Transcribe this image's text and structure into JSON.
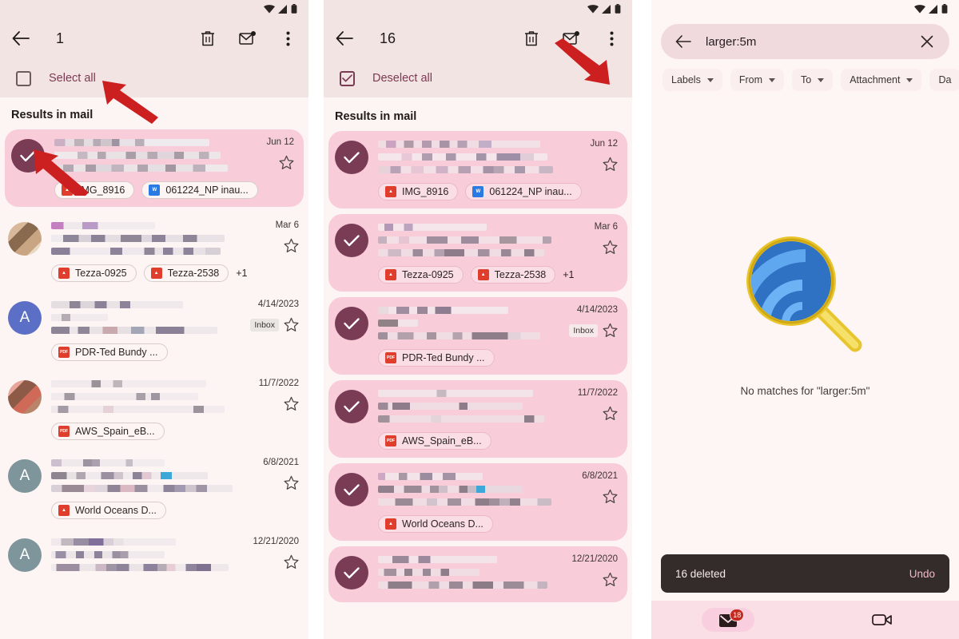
{
  "panel1": {
    "status_icons": [
      "wifi-icon",
      "signal-icon",
      "battery-icon"
    ],
    "actionbar": {
      "back": "back-arrow-icon",
      "count": "1",
      "delete": "trash-icon",
      "mark_unread": "mark-unread-icon",
      "more": "overflow-menu-icon"
    },
    "select_all_label": "Select all",
    "results_header": "Results in mail",
    "rows": [
      {
        "selected": true,
        "avatar_type": "check",
        "avatar_label": "",
        "date": "Jun 12",
        "tag": "",
        "chips": [
          {
            "label": "IMG_8916",
            "type": "img"
          },
          {
            "label": "061224_NP inau...",
            "type": "doc"
          }
        ],
        "extra": ""
      },
      {
        "selected": false,
        "avatar_type": "photo-tan",
        "avatar_label": "",
        "date": "Mar 6",
        "tag": "",
        "chips": [
          {
            "label": "Tezza-0925",
            "type": "img"
          },
          {
            "label": "Tezza-2538",
            "type": "img"
          }
        ],
        "extra": "+1"
      },
      {
        "selected": false,
        "avatar_type": "letter-blue",
        "avatar_label": "A",
        "date": "4/14/2023",
        "tag": "Inbox",
        "chips": [
          {
            "label": "PDR-Ted Bundy ...",
            "type": "pdf"
          }
        ],
        "extra": ""
      },
      {
        "selected": false,
        "avatar_type": "photo-red",
        "avatar_label": "",
        "date": "11/7/2022",
        "tag": "",
        "chips": [
          {
            "label": "AWS_Spain_eB...",
            "type": "pdf"
          }
        ],
        "extra": ""
      },
      {
        "selected": false,
        "avatar_type": "letter-gray",
        "avatar_label": "A",
        "date": "6/8/2021",
        "tag": "",
        "chips": [
          {
            "label": "World Oceans D...",
            "type": "img"
          }
        ],
        "extra": ""
      },
      {
        "selected": false,
        "avatar_type": "letter-gray",
        "avatar_label": "A",
        "date": "12/21/2020",
        "tag": "",
        "chips": [],
        "extra": ""
      }
    ]
  },
  "panel2": {
    "actionbar": {
      "back": "back-arrow-icon",
      "count": "16",
      "delete": "trash-icon",
      "mark_unread": "mark-unread-icon",
      "more": "overflow-menu-icon"
    },
    "select_all_label": "Deselect all",
    "results_header": "Results in mail",
    "rows": [
      {
        "date": "Jun 12",
        "tag": "",
        "chips": [
          {
            "label": "IMG_8916",
            "type": "img"
          },
          {
            "label": "061224_NP inau...",
            "type": "doc"
          }
        ],
        "extra": ""
      },
      {
        "date": "Mar 6",
        "tag": "",
        "chips": [
          {
            "label": "Tezza-0925",
            "type": "img"
          },
          {
            "label": "Tezza-2538",
            "type": "img"
          }
        ],
        "extra": "+1"
      },
      {
        "date": "4/14/2023",
        "tag": "Inbox",
        "chips": [
          {
            "label": "PDR-Ted Bundy ...",
            "type": "pdf"
          }
        ],
        "extra": ""
      },
      {
        "date": "11/7/2022",
        "tag": "",
        "chips": [
          {
            "label": "AWS_Spain_eB...",
            "type": "pdf"
          }
        ],
        "extra": ""
      },
      {
        "date": "6/8/2021",
        "tag": "",
        "chips": [
          {
            "label": "World Oceans D...",
            "type": "img"
          }
        ],
        "extra": ""
      },
      {
        "date": "12/21/2020",
        "tag": "",
        "chips": [],
        "extra": ""
      }
    ]
  },
  "panel3": {
    "search": {
      "back": "back-arrow-icon",
      "query": "larger:5m",
      "clear": "close-icon"
    },
    "filters": [
      {
        "label": "Labels"
      },
      {
        "label": "From"
      },
      {
        "label": "To"
      },
      {
        "label": "Attachment"
      },
      {
        "label": "Da"
      }
    ],
    "empty_state": {
      "illustration": "magnifying-glass-illustration",
      "message": "No matches for \"larger:5m\""
    },
    "snackbar": {
      "message": "16 deleted",
      "action": "Undo"
    },
    "bottom_nav": [
      {
        "icon": "mail-icon",
        "badge": "18",
        "active": true
      },
      {
        "icon": "video-call-icon",
        "badge": "",
        "active": false
      }
    ]
  },
  "colors": {
    "selected_row": "#f9ccd9",
    "appbar": "#f3e4e4",
    "accent": "#7a3b55",
    "badge_red": "#c5291f",
    "snackbar": "#332c2b",
    "arrow_red": "#cc1f1f"
  }
}
